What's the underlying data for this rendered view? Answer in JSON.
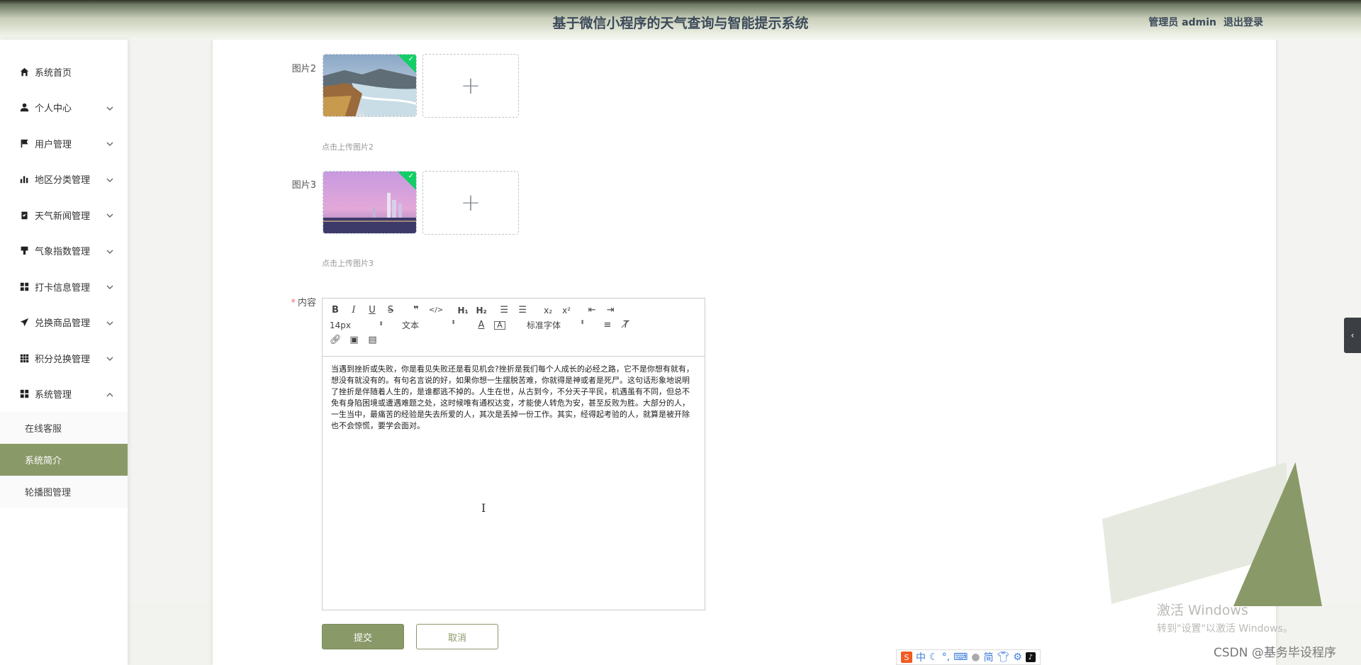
{
  "header": {
    "title": "基于微信小程序的天气查询与智能提示系统",
    "user_label": "管理员 admin",
    "logout_label": "退出登录"
  },
  "sidebar": {
    "items": [
      {
        "label": "系统首页",
        "icon": "home-icon"
      },
      {
        "label": "个人中心",
        "icon": "user-icon"
      },
      {
        "label": "用户管理",
        "icon": "flag-icon"
      },
      {
        "label": "地区分类管理",
        "icon": "bar-chart-icon"
      },
      {
        "label": "天气新闻管理",
        "icon": "clipboard-icon"
      },
      {
        "label": "气象指数管理",
        "icon": "brush-icon"
      },
      {
        "label": "打卡信息管理",
        "icon": "grid-icon"
      },
      {
        "label": "兑换商品管理",
        "icon": "send-icon"
      },
      {
        "label": "积分兑换管理",
        "icon": "apps-icon"
      },
      {
        "label": "系统管理",
        "icon": "grid-icon"
      }
    ],
    "submenu": [
      "在线客服",
      "系统简介",
      "轮播图管理"
    ],
    "active_submenu": "系统简介"
  },
  "form": {
    "image2_label": "图片2",
    "image2_tip": "点击上传图片2",
    "image3_label": "图片3",
    "image3_tip": "点击上传图片3",
    "content_label": "内容",
    "upload_plus": "+"
  },
  "editor": {
    "font_size": "14px",
    "block_format": "文本",
    "font_family": "标准字体",
    "text": "当遇到挫折或失败，你是看见失败还是看见机会?挫折是我们每个人成长的必经之路，它不是你想有就有，想没有就没有的。有句名言说的好，如果你想一生摆脱苦难，你就得是神或者是死尸。这句话形象地说明了挫折是伴随着人生的，是谁都逃不掉的。人生在世，从古到今，不分天子平民，机遇虽有不同，但总不免有身陷困境或遭遇难题之处，这时候唯有通权达变，才能使人转危为安，甚至反败为胜。大部分的人，一生当中，最痛苦的经验是失去所爱的人，其次是丢掉一份工作。其实，经得起考验的人，就算是被开除也不会惊慌，要学会面对。"
  },
  "buttons": {
    "submit": "提交",
    "cancel": "取消"
  },
  "watermark": {
    "line1": "激活 Windows",
    "line2": "转到\"设置\"以激活 Windows。"
  },
  "ime": {
    "items": [
      "中",
      "简"
    ]
  },
  "credit": "CSDN @基务毕设程序",
  "colors": {
    "accent": "#8a9968",
    "header_text": "#3c4a5a"
  }
}
